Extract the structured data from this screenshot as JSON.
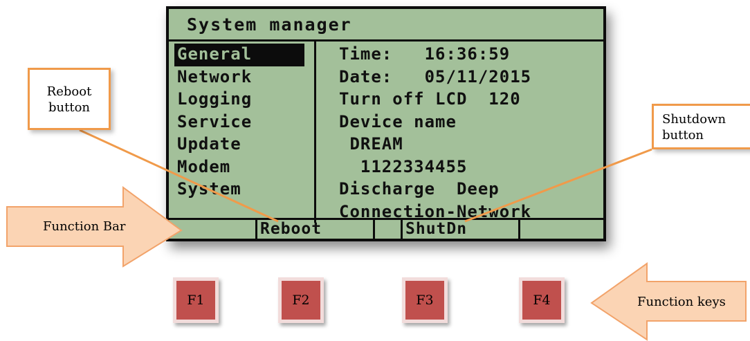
{
  "lcd": {
    "title": "System manager",
    "menu": [
      "General",
      "Network",
      "Logging",
      "Service",
      "Update",
      "Modem",
      "System"
    ],
    "selected_menu": "General",
    "info": [
      "Time:   16:36:59",
      "Date:   05/11/2015",
      "Turn off LCD  120",
      "Device name",
      " DREAM",
      "  1122334455",
      "Discharge  Deep",
      "Connection-Network"
    ],
    "function_bar": [
      "",
      "Reboot",
      "",
      "ShutDn",
      ""
    ]
  },
  "callouts": {
    "reboot": "Reboot button",
    "shutdown": "Shutdown button",
    "function_bar": "Function Bar",
    "function_keys": "Function keys"
  },
  "keys": [
    "F1",
    "F2",
    "F3",
    "F4"
  ],
  "colors": {
    "lcd_background": "#a3c09a",
    "callout_border": "#f09a4a",
    "arrow_fill": "#fbd4b4",
    "key_fill": "#c0504d"
  }
}
